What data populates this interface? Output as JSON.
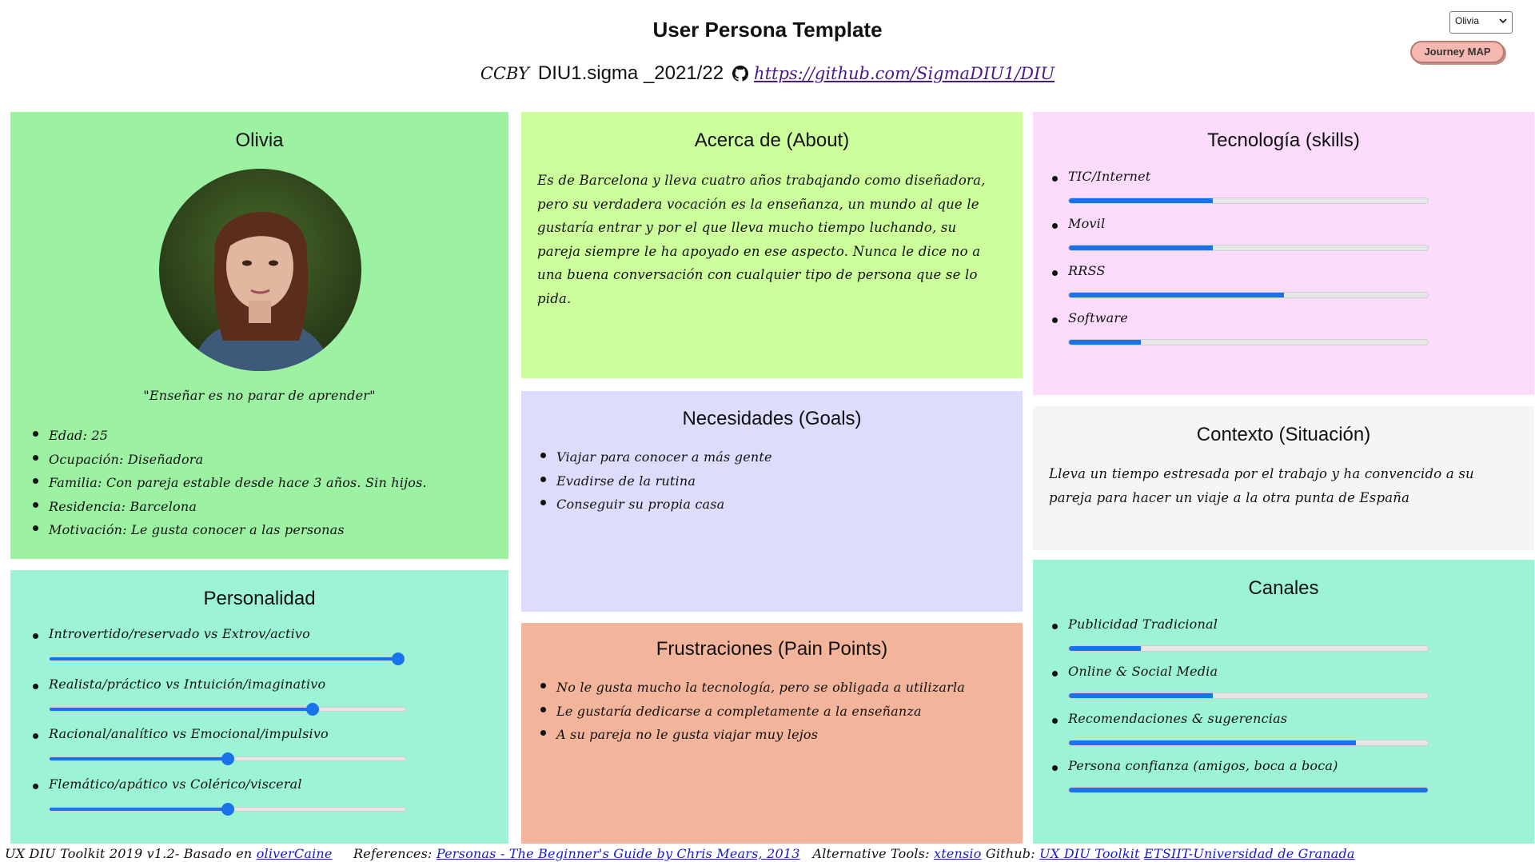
{
  "header": {
    "title": "User Persona Template",
    "license": "CCBY",
    "project": "DIU1.sigma _2021/22",
    "repo_link": "https://github.com/SigmaDIU1/DIU"
  },
  "persona_select": {
    "value": "Olivia"
  },
  "journey_button": "Journey MAP",
  "profile": {
    "name": "Olivia",
    "quote": "\"Enseñar es no parar de aprender\"",
    "facts": [
      "Edad: 25",
      "Ocupación: Diseñadora",
      "Familia: Con pareja estable desde hace 3 años. Sin hijos.",
      "Residencia: Barcelona",
      "Motivación: Le gusta conocer a las personas"
    ]
  },
  "personality": {
    "title": "Personalidad",
    "traits": [
      {
        "label": "Introvertido/reservado vs Extrov/activo",
        "value": 0.98
      },
      {
        "label": "Realista/práctico vs Intuición/imaginativo",
        "value": 0.74
      },
      {
        "label": "Racional/analítico vs Emocional/impulsivo",
        "value": 0.5
      },
      {
        "label": "Flemático/apático vs Colérico/visceral",
        "value": 0.5
      }
    ]
  },
  "about": {
    "title": "Acerca de (About)",
    "text": "Es de Barcelona y lleva cuatro años trabajando como diseñadora, pero su verdadera vocación es la enseñanza, un mundo al que le gustaría entrar y por el que lleva mucho tiempo luchando, su pareja siempre le ha apoyado en ese aspecto. Nunca le dice no a una buena conversación con cualquier tipo de persona que se lo pida."
  },
  "goals": {
    "title": "Necesidades (Goals)",
    "items": [
      "Viajar para conocer a más gente",
      "Evadirse de la rutina",
      "Conseguir su propia casa"
    ]
  },
  "frustrations": {
    "title": "Frustraciones (Pain Points)",
    "items": [
      "No le gusta mucho la tecnología, pero se obligada a utilizarla",
      "Le gustaría dedicarse a completamente a la enseñanza",
      "A su pareja no le gusta viajar muy lejos"
    ]
  },
  "skills": {
    "title": "Tecnología (skills)",
    "items": [
      {
        "label": "TIC/Internet",
        "value": 0.4
      },
      {
        "label": "Movil",
        "value": 0.4
      },
      {
        "label": "RRSS",
        "value": 0.6
      },
      {
        "label": "Software",
        "value": 0.2
      }
    ]
  },
  "context": {
    "title": "Contexto (Situación)",
    "text": "Lleva un tiempo estresada por el trabajo y ha convencido a su pareja para hacer un viaje a la otra punta de España"
  },
  "channels": {
    "title": "Canales",
    "items": [
      {
        "label": "Publicidad Tradicional",
        "value": 0.2
      },
      {
        "label": "Online & Social Media",
        "value": 0.4
      },
      {
        "label": "Recomendaciones & sugerencias",
        "value": 0.8
      },
      {
        "label": "Persona confianza (amigos, boca a boca)",
        "value": 1.0
      }
    ]
  },
  "footer": {
    "toolkit": "UX DIU Toolkit 2019 v1.2- Basado en",
    "based_link": "oliverCaine",
    "references_label": "References:",
    "references_link": "Personas - The Beginner's Guide by Chris Mears, 2013",
    "alt_tools_label": "Alternative Tools:",
    "alt_tools_link": "xtensio",
    "github_label": "Github:",
    "github_link": "UX DIU Toolkit",
    "univ_link": "ETSIIT-Universidad de Granada"
  },
  "colors": {
    "profile_bg": "#9df1a3",
    "personality_bg": "#9df3d6",
    "about_bg": "#ccff9c",
    "goals_bg": "#dcdcfc",
    "frustrations_bg": "#f2b49a",
    "skills_bg": "#fcdcfc",
    "context_bg": "#f3f5f7",
    "channels_bg": "#9df3d6",
    "accent": "#1a73e8"
  }
}
